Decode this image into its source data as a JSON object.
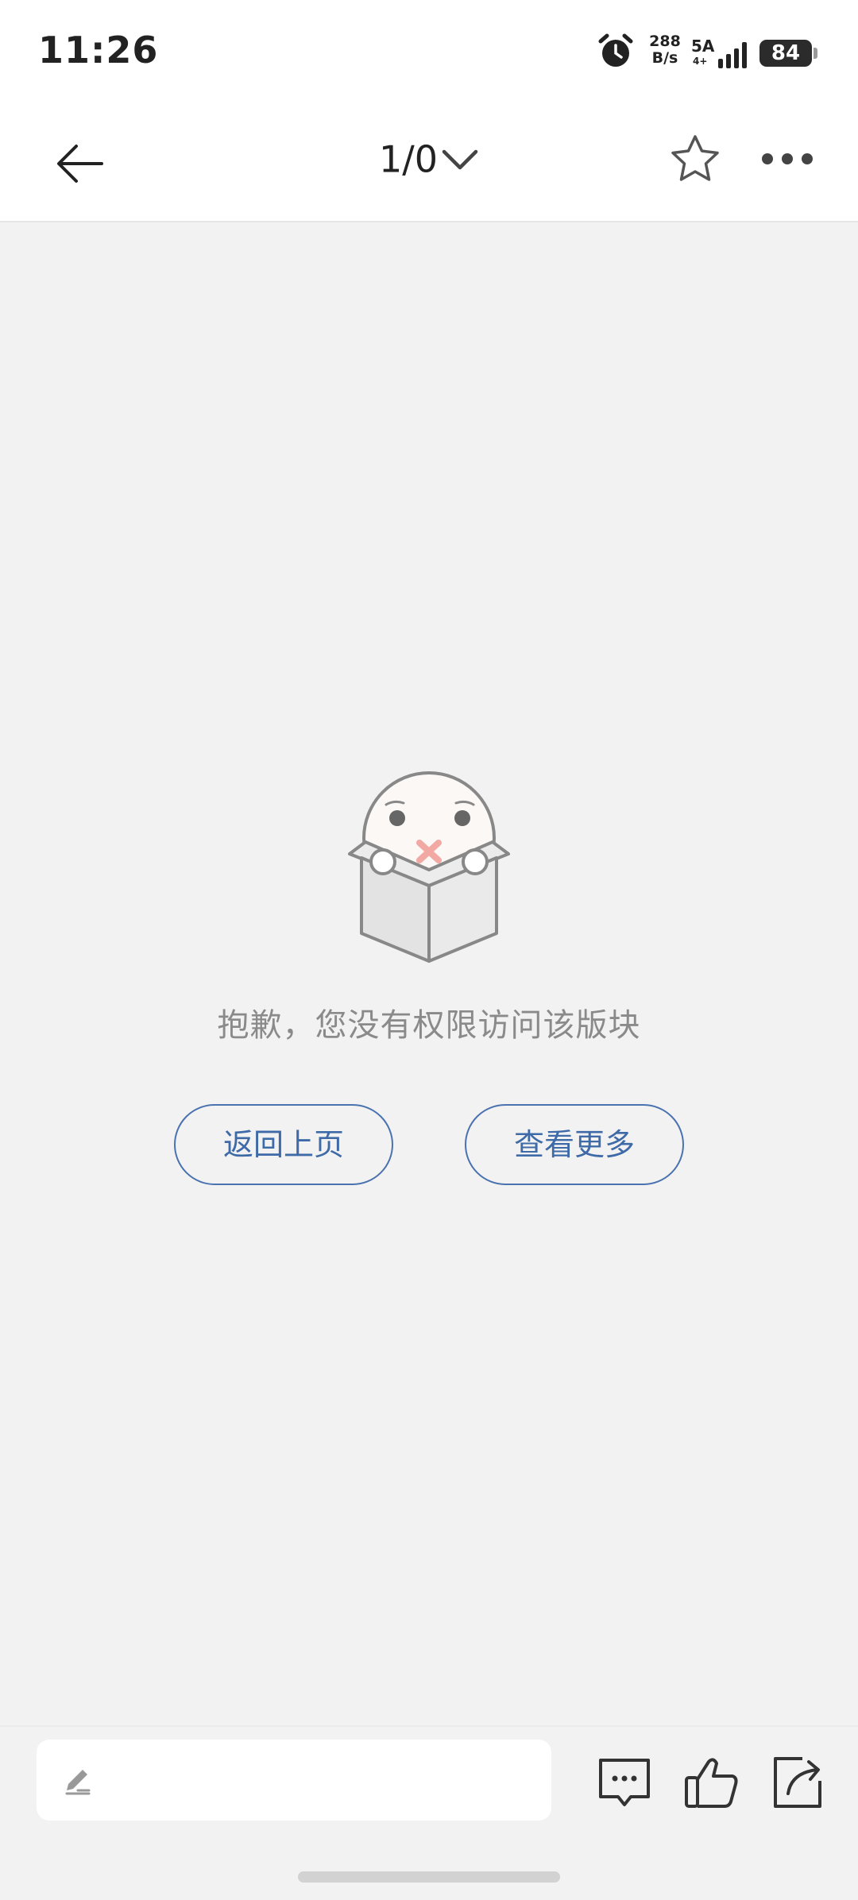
{
  "status_bar": {
    "time": "11:26",
    "net_speed_value": "288",
    "net_speed_unit": "B/s",
    "signal_label": "5A",
    "signal_sub": "4+",
    "battery": "84",
    "icons": [
      "alarm-icon",
      "signal-icon",
      "battery-icon"
    ]
  },
  "nav": {
    "page_indicator": "1/0",
    "icons": [
      "back-arrow-icon",
      "chevron-down-icon",
      "star-icon",
      "more-icon"
    ]
  },
  "empty_state": {
    "message": "抱歉，您没有权限访问该版块",
    "back_button": "返回上页",
    "more_button": "查看更多"
  },
  "bottom_bar": {
    "comment_placeholder": "",
    "icons": [
      "pen-icon",
      "comment-icon",
      "like-icon",
      "share-icon"
    ]
  },
  "colors": {
    "accent": "#4a72b0",
    "background": "#f2f2f2",
    "text_muted": "#8a8a8a"
  }
}
